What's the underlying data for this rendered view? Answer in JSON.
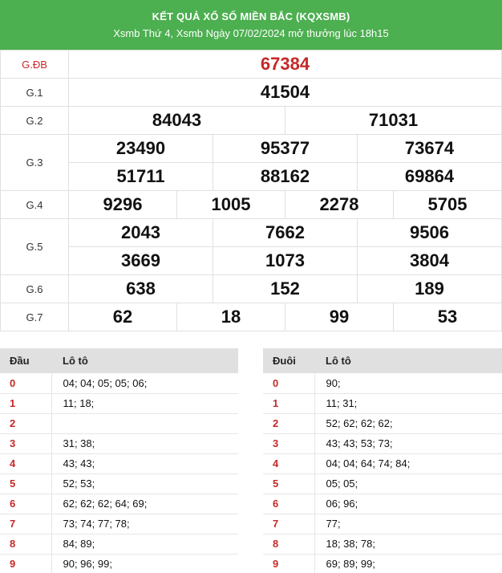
{
  "header": {
    "title": "KẾT QUẢ XỔ SỐ MIỀN BẮC (KQXSMB)",
    "subtitle": "Xsmb Thứ 4, Xsmb Ngày 07/02/2024 mở thưởng lúc 18h15"
  },
  "prizes": {
    "gdb": {
      "label": "G.ĐB",
      "nums": [
        "67384"
      ]
    },
    "g1": {
      "label": "G.1",
      "nums": [
        "41504"
      ]
    },
    "g2": {
      "label": "G.2",
      "nums": [
        "84043",
        "71031"
      ]
    },
    "g3": {
      "label": "G.3",
      "nums": [
        "23490",
        "95377",
        "73674",
        "51711",
        "88162",
        "69864"
      ]
    },
    "g4": {
      "label": "G.4",
      "nums": [
        "9296",
        "1005",
        "2278",
        "5705"
      ]
    },
    "g5": {
      "label": "G.5",
      "nums": [
        "2043",
        "7662",
        "9506",
        "3669",
        "1073",
        "3804"
      ]
    },
    "g6": {
      "label": "G.6",
      "nums": [
        "638",
        "152",
        "189"
      ]
    },
    "g7": {
      "label": "G.7",
      "nums": [
        "62",
        "18",
        "99",
        "53"
      ]
    }
  },
  "dau": {
    "col1": "Đầu",
    "col2": "Lô tô",
    "rows": [
      {
        "k": "0",
        "v": "04; 04; 05; 05; 06;"
      },
      {
        "k": "1",
        "v": "11; 18;"
      },
      {
        "k": "2",
        "v": ""
      },
      {
        "k": "3",
        "v": "31; 38;"
      },
      {
        "k": "4",
        "v": "43; 43;"
      },
      {
        "k": "5",
        "v": "52; 53;"
      },
      {
        "k": "6",
        "v": "62; 62; 62; 64; 69;"
      },
      {
        "k": "7",
        "v": "73; 74; 77; 78;"
      },
      {
        "k": "8",
        "v": "84; 89;"
      },
      {
        "k": "9",
        "v": "90; 96; 99;"
      }
    ]
  },
  "duoi": {
    "col1": "Đuôi",
    "col2": "Lô tô",
    "rows": [
      {
        "k": "0",
        "v": "90;"
      },
      {
        "k": "1",
        "v": "11; 31;"
      },
      {
        "k": "2",
        "v": "52; 62; 62; 62;"
      },
      {
        "k": "3",
        "v": "43; 43; 53; 73;"
      },
      {
        "k": "4",
        "v": "04; 04; 64; 74; 84;"
      },
      {
        "k": "5",
        "v": "05; 05;"
      },
      {
        "k": "6",
        "v": "06; 96;"
      },
      {
        "k": "7",
        "v": "77;"
      },
      {
        "k": "8",
        "v": "18; 38; 78;"
      },
      {
        "k": "9",
        "v": "69; 89; 99;"
      }
    ]
  },
  "colors": {
    "header_bg": "#4caf50",
    "special": "#c62828"
  }
}
